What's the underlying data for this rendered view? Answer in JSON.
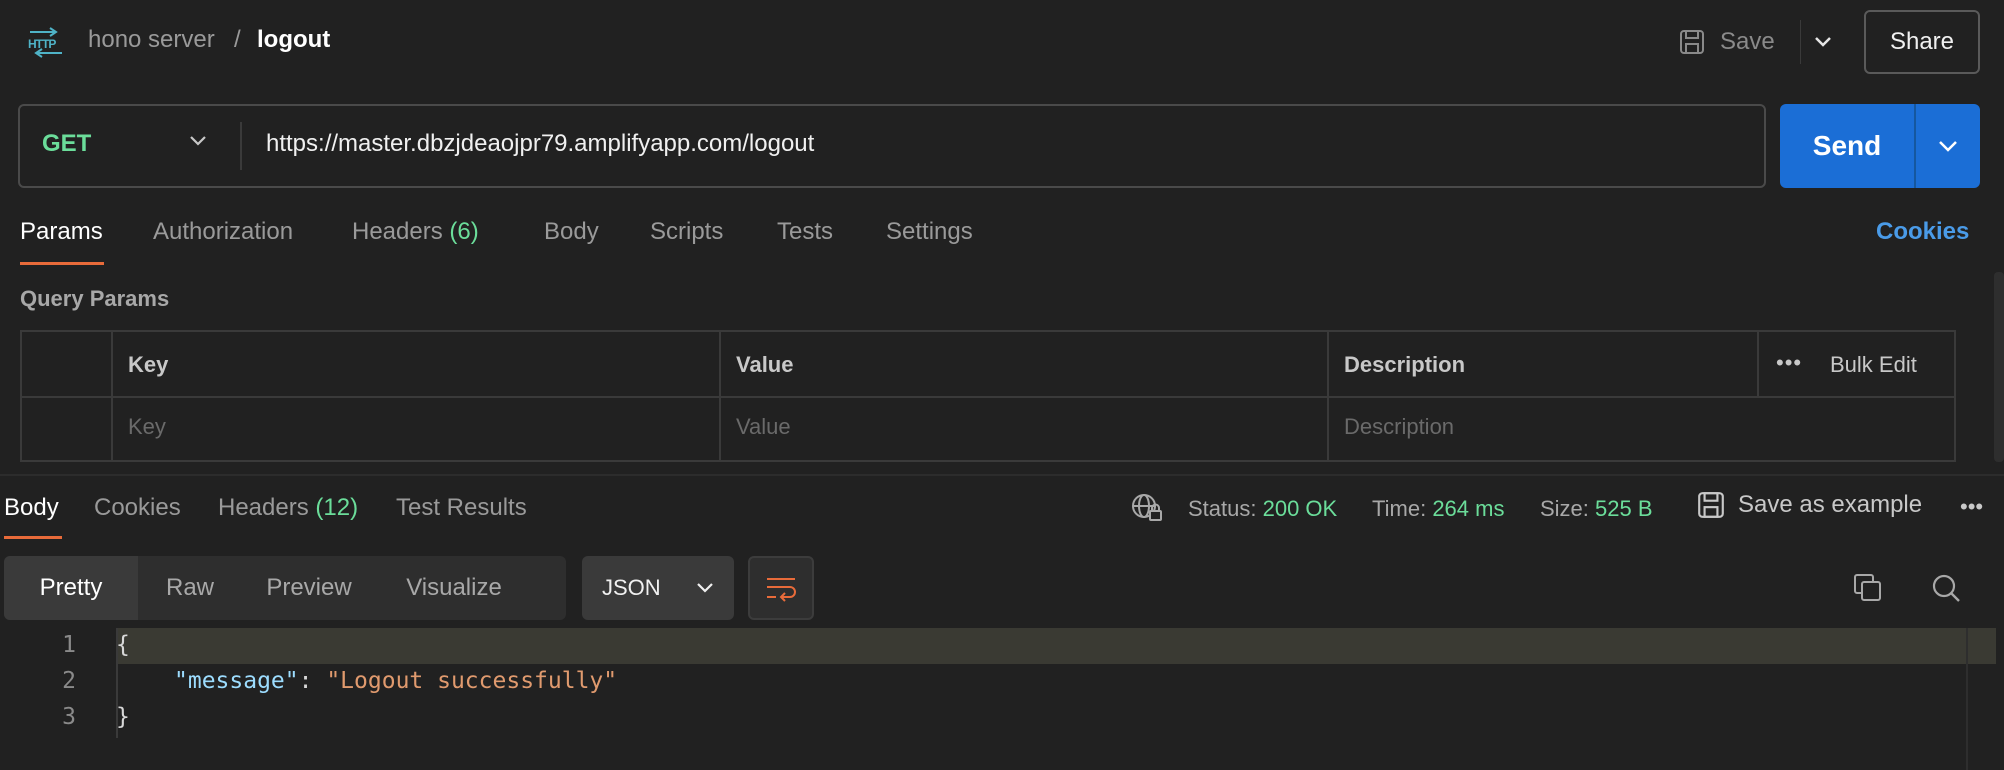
{
  "header": {
    "icon": "http-icon",
    "icon_text": "HTTP",
    "breadcrumb_parent": "hono server",
    "breadcrumb_sep": "/",
    "breadcrumb_current": "logout",
    "save_label": "Save",
    "share_label": "Share"
  },
  "request": {
    "method": "GET",
    "url": "https://master.dbzjdeaojpr79.amplifyapp.com/logout",
    "send_label": "Send"
  },
  "request_tabs": {
    "params": "Params",
    "authorization": "Authorization",
    "headers": "Headers",
    "headers_count": "(6)",
    "body": "Body",
    "scripts": "Scripts",
    "tests": "Tests",
    "settings": "Settings",
    "cookies": "Cookies"
  },
  "query_params": {
    "title": "Query Params",
    "columns": [
      "Key",
      "Value",
      "Description"
    ],
    "bulk_edit": "Bulk Edit",
    "more": "•••",
    "placeholders": [
      "Key",
      "Value",
      "Description"
    ]
  },
  "response": {
    "tabs": {
      "body": "Body",
      "cookies": "Cookies",
      "headers": "Headers",
      "headers_count": "(12)",
      "test_results": "Test Results"
    },
    "status_label": "Status:",
    "status_value": "200 OK",
    "time_label": "Time:",
    "time_value": "264 ms",
    "size_label": "Size:",
    "size_value": "525 B",
    "save_example": "Save as example",
    "more": "•••",
    "views": [
      "Pretty",
      "Raw",
      "Preview",
      "Visualize"
    ],
    "active_view": "Pretty",
    "format": "JSON",
    "code": {
      "line_numbers": [
        "1",
        "2",
        "3"
      ],
      "open_brace": "{",
      "key": "\"message\"",
      "colon": ": ",
      "value": "\"Logout successfully\"",
      "close_brace": "}"
    }
  },
  "colors": {
    "accent_orange": "#e86b3a",
    "send_blue": "#1b6ed6",
    "success_green": "#6bdd9a",
    "link_blue": "#4a9be8"
  }
}
